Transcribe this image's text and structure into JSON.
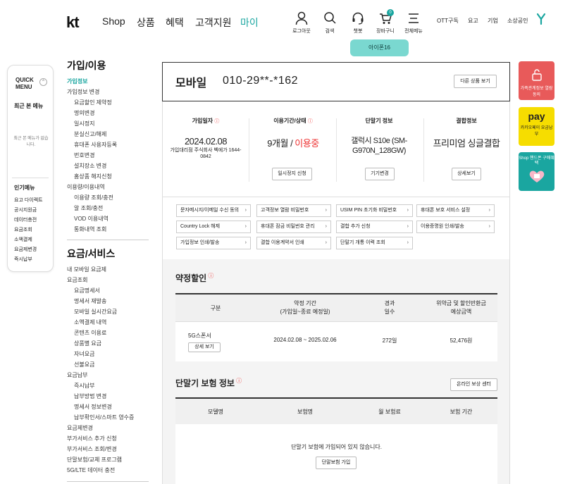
{
  "header": {
    "logo": "kt",
    "gnb": [
      "Shop",
      "상품",
      "혜택",
      "고객지원",
      "마이"
    ],
    "icons": [
      {
        "label": "로그아웃",
        "icon": "person-icon"
      },
      {
        "label": "검색",
        "icon": "search-icon"
      },
      {
        "label": "챗봇",
        "icon": "headset-icon"
      },
      {
        "label": "장바구니",
        "icon": "cart-icon",
        "badge": "0"
      },
      {
        "label": "전체메뉴",
        "icon": "menu-icon"
      }
    ],
    "util": [
      "OTT구독",
      "요고",
      "기업",
      "소상공인"
    ],
    "tooltip": "아이폰16",
    "accent": "#1aa6a0"
  },
  "quick": {
    "title1": "QUICK",
    "title2": "MENU",
    "toggle": "^",
    "recent_title": "최근 본 메뉴",
    "recent_empty": "최근 본 메뉴가 없습니다.",
    "popular_title": "인기메뉴",
    "popular": [
      "요고 다이렉트",
      "공시지원금",
      "데이터충전",
      "요금조회",
      "소액결제",
      "요금제변경",
      "즉시납부"
    ]
  },
  "nav": {
    "section1": "가입/이용",
    "s1_items": [
      {
        "label": "가입정보",
        "level": 1,
        "active": true
      },
      {
        "label": "가입정보 변경",
        "level": 1
      },
      {
        "label": "요금할인 제약정",
        "level": 2
      },
      {
        "label": "명의변경",
        "level": 2
      },
      {
        "label": "일시정지",
        "level": 2
      },
      {
        "label": "분실신고/해제",
        "level": 2
      },
      {
        "label": "휴대폰 사용자등록",
        "level": 2
      },
      {
        "label": "번호변경",
        "level": 2
      },
      {
        "label": "설치장소 변경",
        "level": 2
      },
      {
        "label": "홈상품 해지신청",
        "level": 2
      },
      {
        "label": "이용량/이용내역",
        "level": 1
      },
      {
        "label": "이용량 조회/충전",
        "level": 2
      },
      {
        "label": "알 조회/충전",
        "level": 2
      },
      {
        "label": "VOD 이용내역",
        "level": 2
      },
      {
        "label": "통화내역 조회",
        "level": 2
      }
    ],
    "section2": "요금/서비스",
    "s2_items": [
      {
        "label": "내 모바일 요금제",
        "level": 1
      },
      {
        "label": "요금조회",
        "level": 1
      },
      {
        "label": "요금명세서",
        "level": 2
      },
      {
        "label": "명세서 재발송",
        "level": 2
      },
      {
        "label": "모바일 실시간요금",
        "level": 2
      },
      {
        "label": "소액결제 내역",
        "level": 2
      },
      {
        "label": "콘텐츠 이용료",
        "level": 2
      },
      {
        "label": "상품별 요금",
        "level": 2
      },
      {
        "label": "자녀요금",
        "level": 2
      },
      {
        "label": "선불요금",
        "level": 2
      },
      {
        "label": "요금납부",
        "level": 1
      },
      {
        "label": "즉시납부",
        "level": 2
      },
      {
        "label": "납부방법 변경",
        "level": 2
      },
      {
        "label": "명세서 정보변경",
        "level": 2
      },
      {
        "label": "납부확인서/스마트 영수증",
        "level": 2
      },
      {
        "label": "요금제변경",
        "level": 1
      },
      {
        "label": "부가서비스 추가 신청",
        "level": 1
      },
      {
        "label": "부가서비스 조회/변경",
        "level": 1
      },
      {
        "label": "단말보험/교체 프로그램",
        "level": 1
      },
      {
        "label": "5G/LTE 데이터 충전",
        "level": 1
      }
    ]
  },
  "profile": {
    "type": "모바일",
    "number": "010-29**-*162",
    "other_btn": "다른 상품 보기"
  },
  "info": [
    {
      "head": "가입일자",
      "value": "2024.02.08",
      "sub": "가입대리점 주식회사 벡에가 1644-0842",
      "btn": ""
    },
    {
      "head": "이용기간/상태",
      "value_a": "9개월",
      "value_sep": " / ",
      "value_b": "이용중",
      "btn": "일시정지 신청"
    },
    {
      "head": "단말기 정보",
      "value": "갤럭시 S10e (SM-G970N_128GW)",
      "btn": "기기변경"
    },
    {
      "head": "결합정보",
      "value": "프리미엄 싱글결합",
      "btn": "상세보기"
    }
  ],
  "links": [
    "문자메시지/이메일 수신 동의",
    "고객정보 열람 비밀번호",
    "USIM PIN 초기화 비밀번호",
    "휴대폰 보호 서비스 설정",
    "Country Lock 해제",
    "휴대폰 잠금 비밀번호 관리",
    "결합 추가 신청",
    "이용증명원 인쇄/발송",
    "가입정보 인쇄/발송",
    "결합 이용계약서 인쇄",
    "단말기 개통 이력 조회"
  ],
  "contract": {
    "title": "약정할인",
    "info_mark": "i",
    "headers": [
      "구분",
      "약정 기간",
      "(가입일~종료 예정일)",
      "경과",
      "일수",
      "위약금 및 할인반환금",
      "예상금액"
    ],
    "row": {
      "name": "5G스폰서",
      "detail_btn": "상세 보기",
      "period": "2024.02.08 ~ 2025.02.06",
      "days": "272일",
      "amount": "52,476원"
    }
  },
  "insurance": {
    "title": "단말기 보험 정보",
    "info_mark": "i",
    "center_btn": "온라인 보상 센터",
    "headers": [
      "모델명",
      "보험명",
      "월 보험료",
      "보험 기간"
    ],
    "empty": "단말기 보험에 가입되어 있지 않습니다.",
    "join_btn": "단말보험 가입"
  },
  "banners": [
    {
      "label": "가족관계정보 열람동의",
      "color": "#e85a5a"
    },
    {
      "label": "카카오페이 요금납부",
      "brand": "pay",
      "color": "#f6dd00"
    },
    {
      "label": "Shop 핸드폰 구매혜택",
      "color": "#1aa6a0"
    }
  ]
}
